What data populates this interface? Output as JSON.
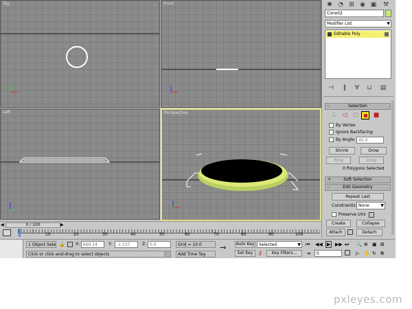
{
  "viewports": {
    "top": {
      "label": "Top"
    },
    "front": {
      "label": "Front"
    },
    "left": {
      "label": "Left"
    },
    "perspective": {
      "label": "Perspective"
    }
  },
  "command_panel": {
    "object_name": "Cone02",
    "object_color": "#c8e878",
    "modifier_list": "Modifier List",
    "stack_item": "Editable Poly",
    "selection_title": "Selection",
    "by_vertex": "By Vertex",
    "ignore_backfacing": "Ignore Backfacing",
    "by_angle": "By Angle:",
    "angle_value": "45.0",
    "shrink": "Shrink",
    "grow": "Grow",
    "ring": "Ring",
    "loop": "Loop",
    "selected_status": "0 Polygons Selected",
    "soft_selection_title": "Soft Selection",
    "soft_selection_sign": "+",
    "edit_geometry_title": "Edit Geometry",
    "edit_geometry_sign": "-",
    "repeat_last": "Repeat Last",
    "constraints_label": "Constraints:",
    "constraints_value": "None",
    "preserve_uvs": "Preserve UVs",
    "create": "Create",
    "collapse": "Collapse",
    "attach": "Attach",
    "detach": "Detach"
  },
  "timeline": {
    "frame_counter": "0 / 100",
    "ticks": [
      "10",
      "20",
      "30",
      "40",
      "50",
      "60",
      "70",
      "80",
      "90",
      "100"
    ]
  },
  "status": {
    "selection": "1 Object Sele",
    "x_label": "X:",
    "x_value": "669.14",
    "y_label": "Y:",
    "y_value": "-1.137",
    "z_label": "Z:",
    "z_value": "0.0",
    "grid": "Grid = 10.0",
    "auto_key": "Auto Key",
    "selected": "Selected",
    "set_key": "Set Key",
    "key_filters": "Key Filters...",
    "frame_value": "0",
    "prompt": "Click or click-and-drag to select objects",
    "add_time_tag": "Add Time Tag"
  },
  "watermark": "pxleyes.com",
  "colors": {
    "viewport_bg": "#8b8b8b",
    "active_border": "#e4e48a",
    "object_rim": "#c8e068",
    "panel_bg": "#c8c8c8"
  }
}
